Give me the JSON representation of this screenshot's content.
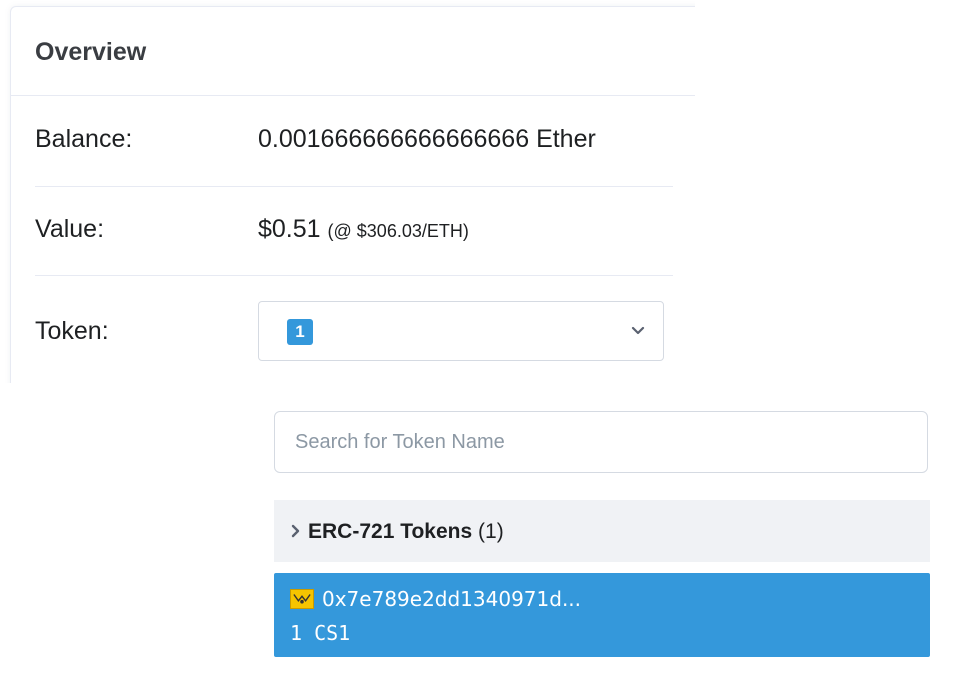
{
  "overview": {
    "title": "Overview",
    "balance": {
      "label": "Balance:",
      "value": "0.001666666666666666 Ether"
    },
    "value": {
      "label": "Value:",
      "amount": "$0.51",
      "rate": "(@ $306.03/ETH)"
    },
    "token": {
      "label": "Token:",
      "count_badge": "1"
    }
  },
  "dropdown": {
    "search_placeholder": "Search for Token Name",
    "search_value": "",
    "group": {
      "title": "ERC-721 Tokens",
      "count": "(1)"
    },
    "items": [
      {
        "address": "0x7e789e2dd1340971d...",
        "amount": "1 CS1",
        "icon": "token-logo-icon"
      }
    ]
  },
  "colors": {
    "accent": "#3498db",
    "group_bg": "#f0f2f5",
    "border": "#d5dae2",
    "divider": "#e7eaf3"
  }
}
